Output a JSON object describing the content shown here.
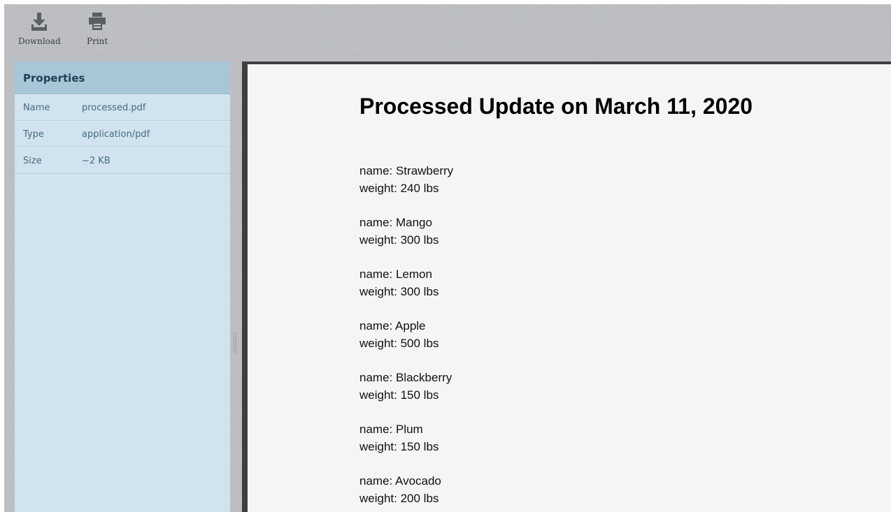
{
  "toolbar": {
    "download_label": "Download",
    "print_label": "Print"
  },
  "properties": {
    "title": "Properties",
    "rows": [
      {
        "key": "Name",
        "value": "processed.pdf"
      },
      {
        "key": "Type",
        "value": "application/pdf"
      },
      {
        "key": "Size",
        "value": "~2 KB"
      }
    ]
  },
  "document": {
    "title": "Processed Update on March 11, 2020",
    "entries": [
      {
        "name": "name: Strawberry",
        "weight": "weight: 240 lbs"
      },
      {
        "name": "name: Mango",
        "weight": "weight: 300 lbs"
      },
      {
        "name": "name: Lemon",
        "weight": "weight: 300 lbs"
      },
      {
        "name": "name: Apple",
        "weight": "weight: 500 lbs"
      },
      {
        "name": "name: Blackberry",
        "weight": "weight: 150 lbs"
      },
      {
        "name": "name: Plum",
        "weight": "weight: 150 lbs"
      },
      {
        "name": "name: Avocado",
        "weight": "weight: 200 lbs"
      }
    ]
  },
  "icons": {
    "download": "download-icon",
    "print": "printer-icon"
  },
  "colors": {
    "sidebar_bg": "#d1e3ee",
    "sidebar_header_bg": "#a8c6d6",
    "viewer_bg": "#3d3f42",
    "page_bg": "#f5f5f5"
  }
}
